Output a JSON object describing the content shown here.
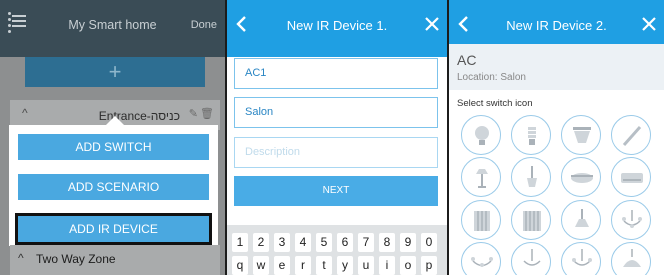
{
  "panel1": {
    "title": "My Smart home",
    "done_label": "Done",
    "add_symbol": "+",
    "room_name": "Entrance-כניסה",
    "popup_buttons": [
      "ADD SWITCH",
      "ADD SCENARIO",
      "ADD IR DEVICE"
    ],
    "selected_button": "ADD IR DEVICE",
    "zone_name": "Two Way Zone"
  },
  "panel2": {
    "title": "New IR Device 1.",
    "name_value": "AC1",
    "location_value": "Salon",
    "description_placeholder": "Description",
    "next_label": "NEXT",
    "keyboard_numbers": [
      "1",
      "2",
      "3",
      "4",
      "5",
      "6",
      "7",
      "8",
      "9",
      "0"
    ],
    "keyboard_letters": [
      "q",
      "w",
      "e",
      "r",
      "t",
      "y",
      "u",
      "i",
      "o",
      "p"
    ]
  },
  "panel3": {
    "title": "New IR Device 2.",
    "device_name": "AC",
    "location_label": "Location:",
    "location_value": "Salon",
    "select_icon_label": "Select switch icon",
    "icons": [
      "bulb-icon",
      "cfl-bulb-icon",
      "downlight-icon",
      "light-tube-icon",
      "floor-lamp-icon",
      "pendant-lamp-icon",
      "ceiling-light-icon",
      "ac-unit-icon",
      "curtain-icon",
      "shutter-icon",
      "table-lamp-icon",
      "chandelier-icon",
      "chandelier-2-icon",
      "chandelier-3-icon",
      "chandelier-4-icon",
      "dome-lamp-icon"
    ]
  },
  "colors": {
    "accent": "#1f9fe3",
    "header_dark": "#3a4c56",
    "button_blue": "#4aa8e0"
  }
}
